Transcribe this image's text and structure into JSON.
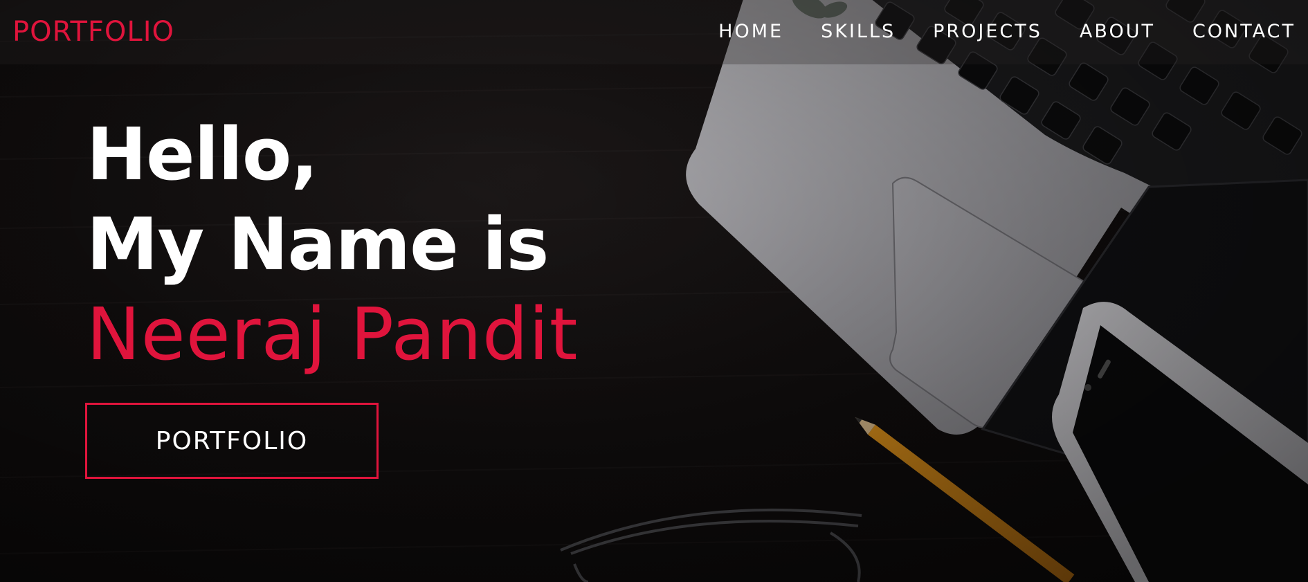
{
  "nav": {
    "brand": "PORTFOLIO",
    "links": [
      {
        "label": "HOME"
      },
      {
        "label": "SKILLS"
      },
      {
        "label": "PROJECTS"
      },
      {
        "label": "ABOUT"
      },
      {
        "label": "CONTACT"
      }
    ]
  },
  "hero": {
    "greeting": "Hello,",
    "intro": "My Name is",
    "name": "Neeraj Pandit",
    "cta_label": "PORTFOLIO"
  },
  "colors": {
    "accent": "#e0143c",
    "text": "#ffffff",
    "background": "#0d0b0b"
  }
}
